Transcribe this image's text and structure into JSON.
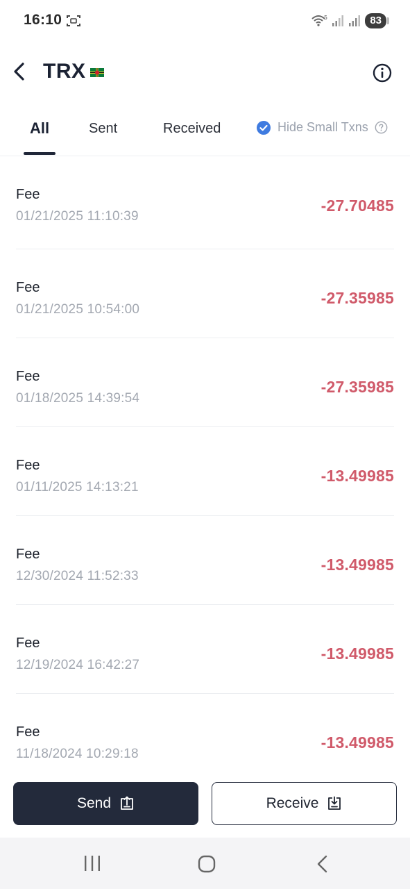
{
  "status_bar": {
    "time": "16:10",
    "battery": "83",
    "wifi_label": "5"
  },
  "header": {
    "title": "TRX"
  },
  "tabs": {
    "all": "All",
    "sent": "Sent",
    "received": "Received",
    "hide_small": "Hide Small Txns",
    "hide_small_checked": true
  },
  "transactions": [
    {
      "type": "Fee",
      "date": "01/21/2025 11:10:39",
      "amount": "-27.70485"
    },
    {
      "type": "Fee",
      "date": "01/21/2025 10:54:00",
      "amount": "-27.35985"
    },
    {
      "type": "Fee",
      "date": "01/18/2025 14:39:54",
      "amount": "-27.35985"
    },
    {
      "type": "Fee",
      "date": "01/11/2025 14:13:21",
      "amount": "-13.49985"
    },
    {
      "type": "Fee",
      "date": "12/30/2024 11:52:33",
      "amount": "-13.49985"
    },
    {
      "type": "Fee",
      "date": "12/19/2024 16:42:27",
      "amount": "-13.49985"
    },
    {
      "type": "Fee",
      "date": "11/18/2024 10:29:18",
      "amount": "-13.49985"
    }
  ],
  "actions": {
    "send": "Send",
    "receive": "Receive"
  },
  "colors": {
    "accent_dark": "#232a3b",
    "negative": "#d05a6a",
    "check_blue": "#3f7be0"
  }
}
